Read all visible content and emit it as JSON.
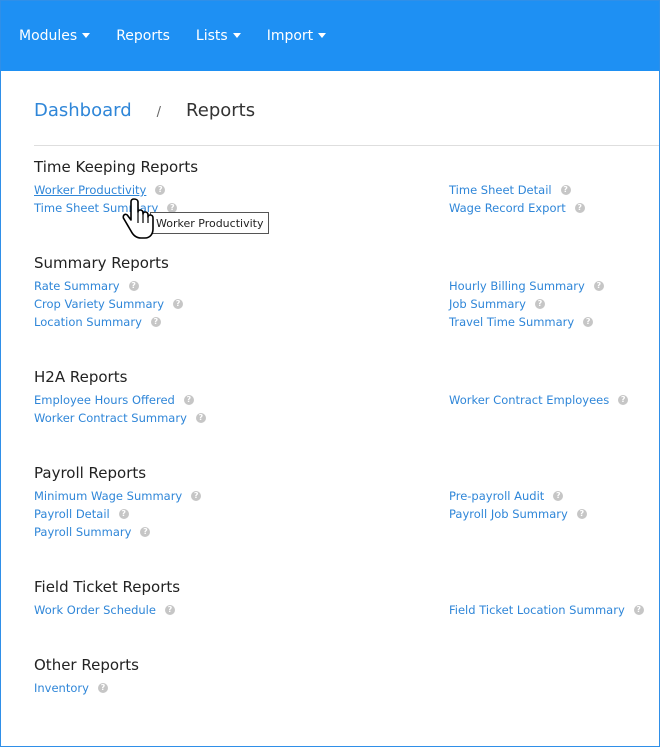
{
  "nav": {
    "items": [
      {
        "label": "Modules",
        "dropdown": true
      },
      {
        "label": "Reports",
        "dropdown": false
      },
      {
        "label": "Lists",
        "dropdown": true
      },
      {
        "label": "Import",
        "dropdown": true
      }
    ]
  },
  "breadcrumb": {
    "home": "Dashboard",
    "separator": "/",
    "current": "Reports"
  },
  "sections": {
    "time_keeping": {
      "title": "Time Keeping Reports",
      "left": [
        "Worker Productivity",
        "Time Sheet Summary"
      ],
      "right": [
        "Time Sheet Detail",
        "Wage Record Export"
      ]
    },
    "summary": {
      "title": "Summary Reports",
      "left": [
        "Rate Summary",
        "Crop Variety Summary",
        "Location Summary"
      ],
      "right": [
        "Hourly Billing Summary",
        "Job Summary",
        "Travel Time Summary"
      ]
    },
    "h2a": {
      "title": "H2A Reports",
      "left": [
        "Employee Hours Offered",
        "Worker Contract Summary"
      ],
      "right": [
        "Worker Contract Employees"
      ]
    },
    "payroll": {
      "title": "Payroll Reports",
      "left": [
        "Minimum Wage Summary",
        "Payroll Detail",
        "Payroll Summary"
      ],
      "right": [
        "Pre-payroll Audit",
        "Payroll Job Summary"
      ]
    },
    "field_ticket": {
      "title": "Field Ticket Reports",
      "left": [
        "Work Order Schedule"
      ],
      "right": [
        "Field Ticket Location Summary"
      ]
    },
    "other": {
      "title": "Other Reports",
      "left": [
        "Inventory"
      ],
      "right": []
    }
  },
  "help_glyph": "?",
  "tooltip": "Worker Productivity",
  "colors": {
    "navbar": "#1e90f3",
    "link": "#2f86d8",
    "help_icon": "#c6c6c6"
  }
}
